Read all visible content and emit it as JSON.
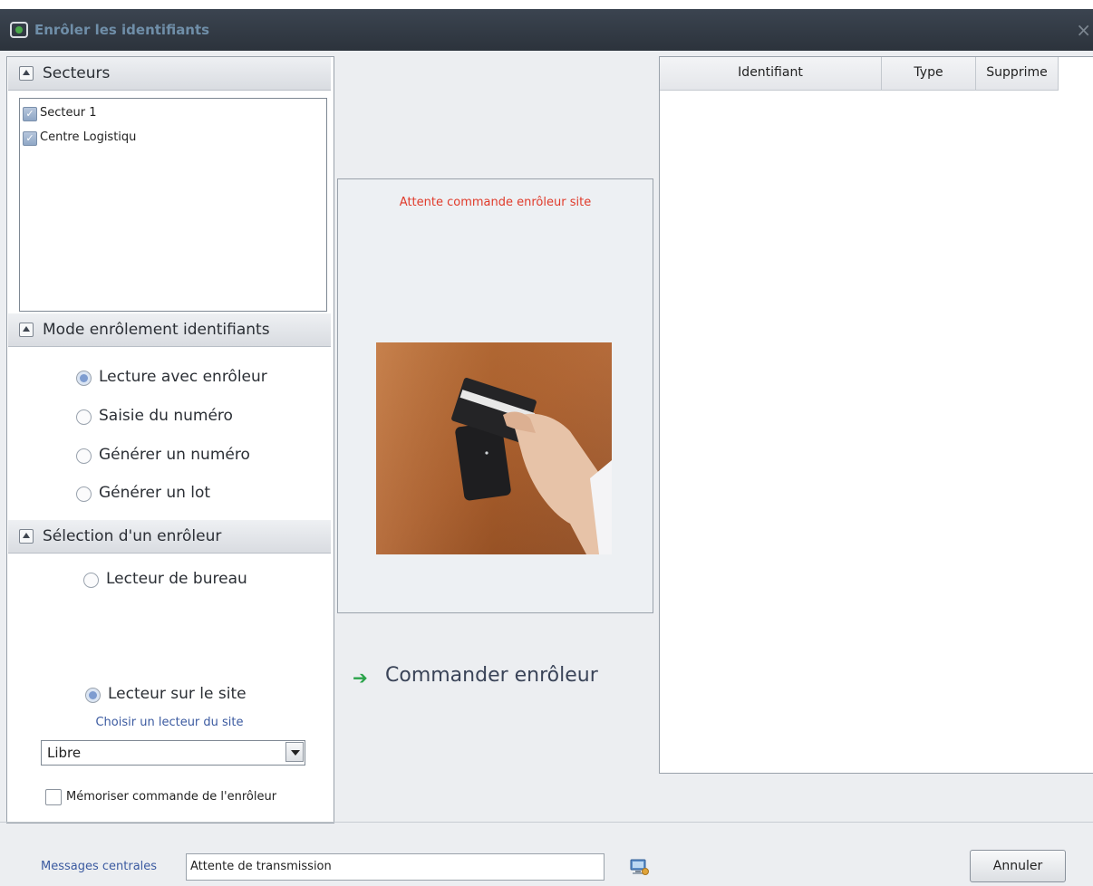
{
  "window": {
    "title": "Enrôler les identifiants",
    "close_glyph": "×"
  },
  "sectors": {
    "header": "Secteurs",
    "items": [
      {
        "label": "Secteur 1",
        "checked": true
      },
      {
        "label": "Centre Logistiqu",
        "checked": true
      }
    ]
  },
  "mode": {
    "header": "Mode enrôlement identifiants",
    "options": [
      {
        "label": "Lecture avec enrôleur",
        "selected": true
      },
      {
        "label": "Saisie du numéro",
        "selected": false
      },
      {
        "label": "Générer un numéro",
        "selected": false
      },
      {
        "label": "Générer un lot",
        "selected": false
      }
    ]
  },
  "enroller": {
    "header": "Sélection d'un enrôleur",
    "options": [
      {
        "label": "Lecteur de bureau",
        "selected": false
      },
      {
        "label": "Lecteur sur le site",
        "selected": true
      }
    ],
    "choose_label": "Choisir un lecteur du site",
    "reader_value": "Libre",
    "memorize_label": "Mémoriser commande de l'enrôleur",
    "memorize_checked": false
  },
  "center": {
    "status": "Attente commande enrôleur site",
    "command_label": "Commander enrôleur"
  },
  "table": {
    "columns": [
      "Identifiant",
      "Type",
      "Supprime"
    ],
    "rows": []
  },
  "footer": {
    "messages_label": "Messages centrales",
    "messages_value": "Attente de transmission",
    "cancel_label": "Annuler"
  },
  "colors": {
    "status_red": "#e03a2a",
    "link_blue": "#3b5aa0",
    "arrow_green": "#2aa34a"
  },
  "icons": {
    "title": "app-window-icon",
    "command": "green-arrow-icon",
    "network": "network-computer-icon"
  }
}
